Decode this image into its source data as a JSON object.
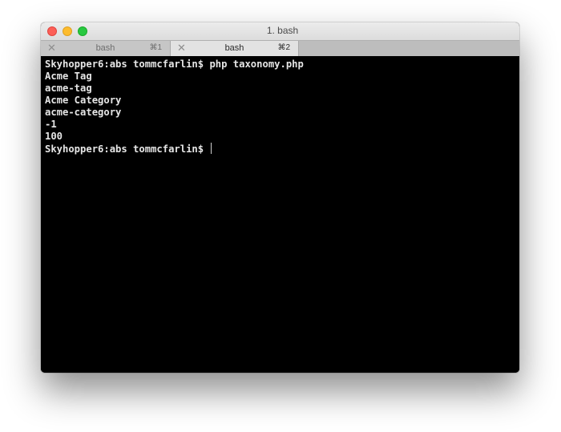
{
  "window": {
    "title": "1. bash"
  },
  "tabs": [
    {
      "label": "bash",
      "shortcut": "⌘1",
      "active": false
    },
    {
      "label": "bash",
      "shortcut": "⌘2",
      "active": true
    }
  ],
  "terminal": {
    "lines": [
      "Skyhopper6:abs tommcfarlin$ php taxonomy.php",
      "Acme Tag",
      "acme-tag",
      "Acme Category",
      "acme-category",
      "-1",
      "100"
    ],
    "prompt": "Skyhopper6:abs tommcfarlin$ "
  },
  "colors": {
    "close": "#fc5f57",
    "minimize": "#fdbc2e",
    "maximize": "#28c840",
    "terminal_bg": "#000000",
    "terminal_fg": "#e6e6e6"
  }
}
